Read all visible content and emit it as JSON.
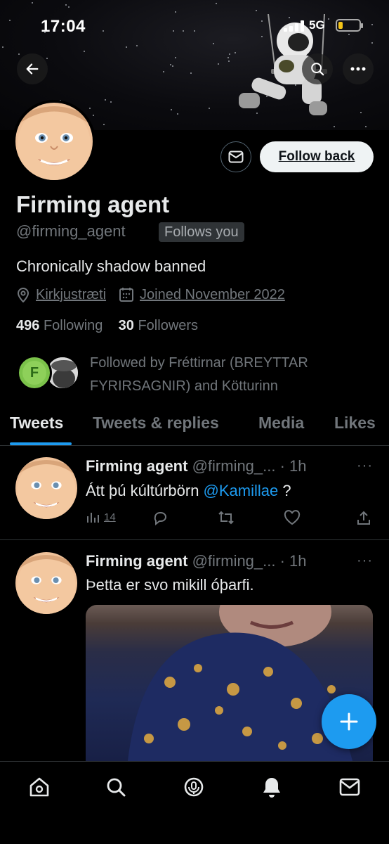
{
  "status_bar": {
    "time": "17:04",
    "network": "5G",
    "battery_level": 0.15
  },
  "banner": {
    "image": "astronaut-on-swing"
  },
  "profile": {
    "name": "Firming agent",
    "handle": "@firming_agent",
    "follows_you": "Follows you",
    "follow_back": "Follow back",
    "bio": "Chronically shadow banned",
    "location": "Kirkjustræti",
    "joined": "Joined November 2022",
    "following_count": "496",
    "following_label": "Following",
    "followers_count": "30",
    "followers_label": "Followers",
    "followed_by_initial": "F",
    "followed_by_line1": "Followed by Fréttirnar (BREYTTAR",
    "followed_by_line2": "FYRIRSAGNIR) and Kötturinn"
  },
  "tabs": [
    {
      "label": "Tweets",
      "active": true
    },
    {
      "label": "Tweets & replies",
      "active": false
    },
    {
      "label": "Media",
      "active": false
    },
    {
      "label": "Likes",
      "active": false
    }
  ],
  "tweets": [
    {
      "name": "Firming agent",
      "handle_time": "@firming_... · 1h",
      "more": "···",
      "text_before": "Átt þú kúltúrbörn ",
      "mention": "@Kamillae",
      "text_after": " ?",
      "views": "14"
    },
    {
      "name": "Firming agent",
      "handle_time": "@firming_... · 1h",
      "more": "···",
      "text": "Þetta er svo mikill óþarfi."
    }
  ],
  "colors": {
    "accent": "#1d9bf0",
    "background": "#000000",
    "muted": "#71767b",
    "text": "#e7e9ea"
  },
  "icons": [
    "back-arrow-icon",
    "search-icon",
    "more-icon",
    "mail-icon",
    "location-pin-icon",
    "calendar-icon",
    "analytics-icon",
    "reply-icon",
    "retweet-icon",
    "like-icon",
    "share-icon",
    "compose-plus-icon",
    "home-icon",
    "spaces-icon",
    "notifications-bell-icon",
    "messages-icon"
  ]
}
